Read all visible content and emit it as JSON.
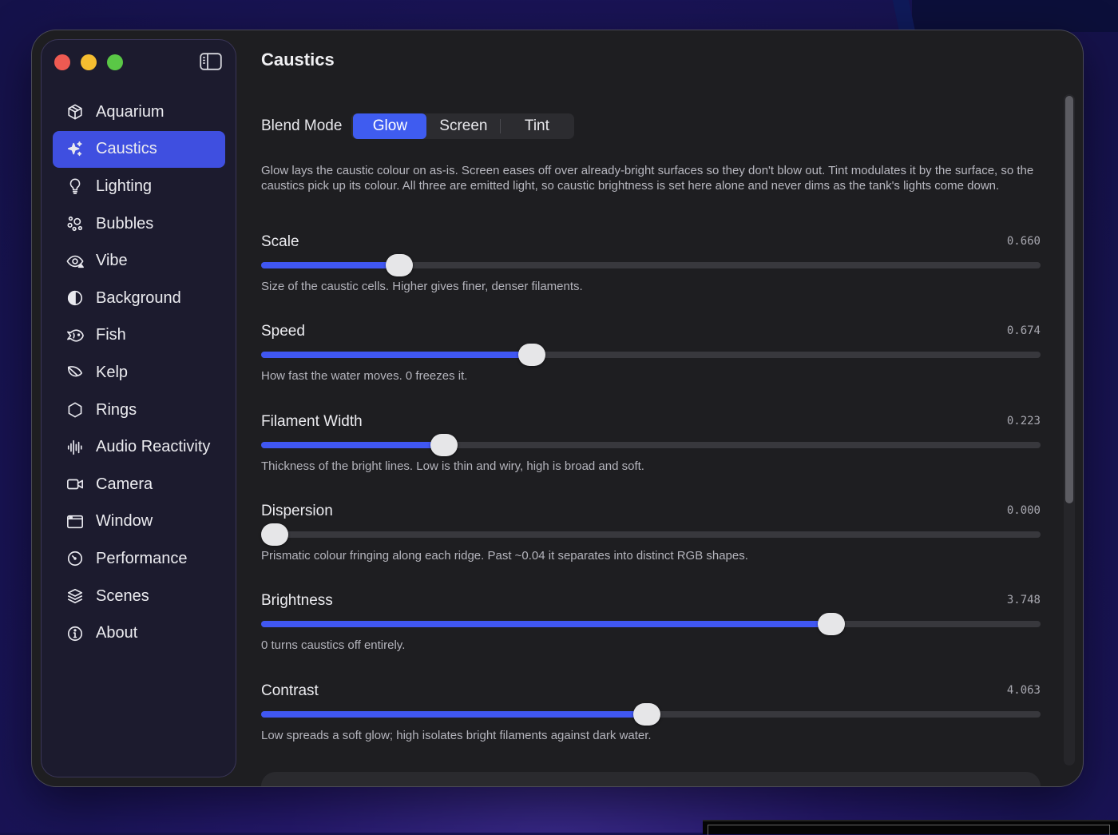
{
  "window": {
    "title": "Caustics",
    "traffic_lights": [
      "close",
      "minimize",
      "zoom"
    ]
  },
  "sidebar": {
    "items": [
      {
        "label": "Aquarium",
        "icon": "cube-icon"
      },
      {
        "label": "Caustics",
        "icon": "sparkles-icon",
        "active": true
      },
      {
        "label": "Lighting",
        "icon": "lightbulb-icon"
      },
      {
        "label": "Bubbles",
        "icon": "bubbles-icon"
      },
      {
        "label": "Vibe",
        "icon": "eye-icon"
      },
      {
        "label": "Background",
        "icon": "half-circle-icon"
      },
      {
        "label": "Fish",
        "icon": "fish-icon"
      },
      {
        "label": "Kelp",
        "icon": "leaf-icon"
      },
      {
        "label": "Rings",
        "icon": "hexagon-icon"
      },
      {
        "label": "Audio Reactivity",
        "icon": "waveform-icon"
      },
      {
        "label": "Camera",
        "icon": "video-camera-icon"
      },
      {
        "label": "Window",
        "icon": "window-icon"
      },
      {
        "label": "Performance",
        "icon": "gauge-icon"
      },
      {
        "label": "Scenes",
        "icon": "layers-icon"
      },
      {
        "label": "About",
        "icon": "info-icon"
      }
    ]
  },
  "main": {
    "title": "Caustics",
    "blend_mode": {
      "label": "Blend Mode",
      "options": [
        "Glow",
        "Screen",
        "Tint"
      ],
      "selected": "Glow",
      "description": "Glow lays the caustic colour on as-is. Screen eases off over already-bright surfaces so they don't blow out. Tint modulates it by the surface, so the caustics pick up its colour. All three are emitted light, so caustic brightness is set here alone and never dims as the tank's lights come down."
    },
    "sliders": [
      {
        "label": "Scale",
        "value_text": "0.660",
        "fraction": 0.166,
        "help": "Size of the caustic cells. Higher gives finer, denser filaments."
      },
      {
        "label": "Speed",
        "value_text": "0.674",
        "fraction": 0.342,
        "help": "How fast the water moves. 0 freezes it."
      },
      {
        "label": "Filament Width",
        "value_text": "0.223",
        "fraction": 0.225,
        "help": "Thickness of the bright lines. Low is thin and wiry, high is broad and soft."
      },
      {
        "label": "Dispersion",
        "value_text": "0.000",
        "fraction": 0.0,
        "help": "Prismatic colour fringing along each ridge. Past ~0.04 it separates into distinct RGB shapes."
      },
      {
        "label": "Brightness",
        "value_text": "3.748",
        "fraction": 0.74,
        "help": "0 turns caustics off entirely."
      },
      {
        "label": "Contrast",
        "value_text": "4.063",
        "fraction": 0.495,
        "help": "Low spreads a soft glow; high isolates bright filaments against dark water."
      }
    ]
  },
  "colors": {
    "accent": "#3f5cf0",
    "window_bg": "#1e1e21",
    "sidebar_bg": "#1c1b2e"
  }
}
